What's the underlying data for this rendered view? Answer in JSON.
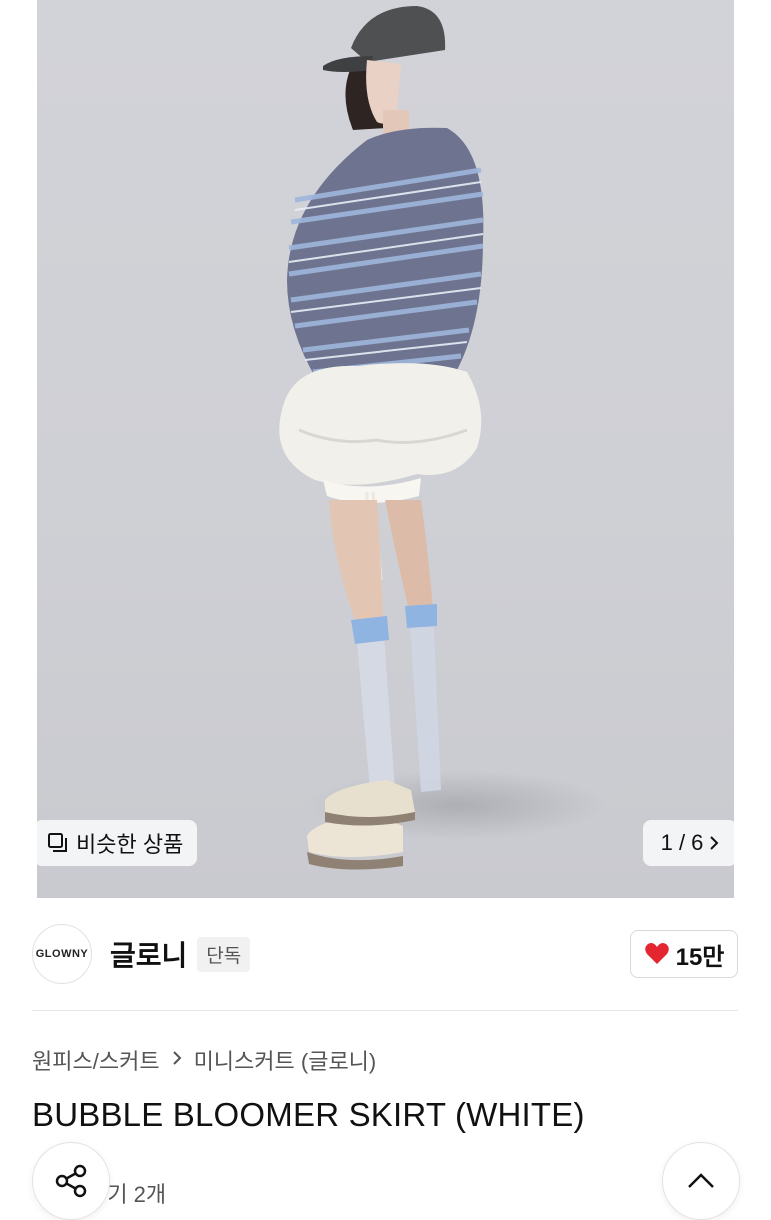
{
  "hero": {
    "similar_label": "비슷한 상품",
    "image_counter": "1 / 6"
  },
  "seller": {
    "logo_text": "GLOWNY",
    "name": "글로니",
    "badge": "단독",
    "like_count": "15만",
    "heart_color": "#e3262f"
  },
  "breadcrumb": {
    "category": "원피스/스커트",
    "subcategory": "미니스커트 (글로니)"
  },
  "product": {
    "title": "BUBBLE BLOOMER SKIRT (WHITE)",
    "reviews": "-기 2개"
  },
  "icons": {
    "similar": "copy-squares-icon",
    "next": "chevron-right-icon",
    "like": "heart-icon",
    "breadcrumb_sep": "chevron-right-icon",
    "share": "share-icon",
    "scroll_top": "chevron-up-icon"
  }
}
